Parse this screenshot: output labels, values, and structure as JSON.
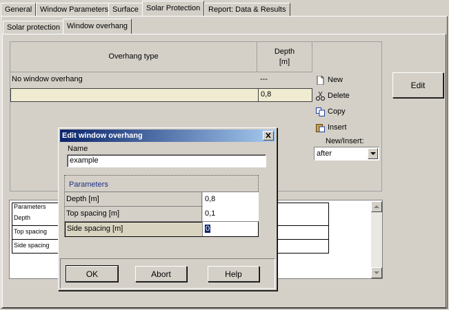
{
  "main_tabs": [
    "General",
    "Window Parameters",
    "Surface",
    "Solar Protection",
    "Report: Data & Results"
  ],
  "active_main_tab": "Solar Protection",
  "sub_tabs": [
    "Solar protection",
    "Window overhang"
  ],
  "active_sub_tab": "Window overhang",
  "grid": {
    "col_type": "Overhang type",
    "col_depth_line1": "Depth",
    "col_depth_line2": "[m]",
    "rows": [
      {
        "type": "No window overhang",
        "depth": "---"
      },
      {
        "type": "",
        "depth": "0,8"
      }
    ]
  },
  "toolbar": {
    "new": "New",
    "delete": "Delete",
    "copy": "Copy",
    "insert": "Insert",
    "new_insert_label": "New/Insert:",
    "new_insert_value": "after"
  },
  "edit_button": "Edit",
  "lower_table": {
    "header": "Parameters",
    "rows": [
      "Depth",
      "Top spacing",
      "Side spacing"
    ]
  },
  "dialog": {
    "title": "Edit window overhang",
    "name_label": "Name",
    "name_value": "example",
    "group_label": "Parameters",
    "params": [
      {
        "label": "Depth  [m]",
        "value": "0,8"
      },
      {
        "label": "Top spacing  [m]",
        "value": "0,1"
      },
      {
        "label": "Side spacing  [m]",
        "value": "0"
      }
    ],
    "ok": "OK",
    "abort": "Abort",
    "help": "Help"
  },
  "colors": {
    "title_bar": "#0a246a",
    "selected_row": "#f0ecd2",
    "group_label": "#1c2f84"
  }
}
